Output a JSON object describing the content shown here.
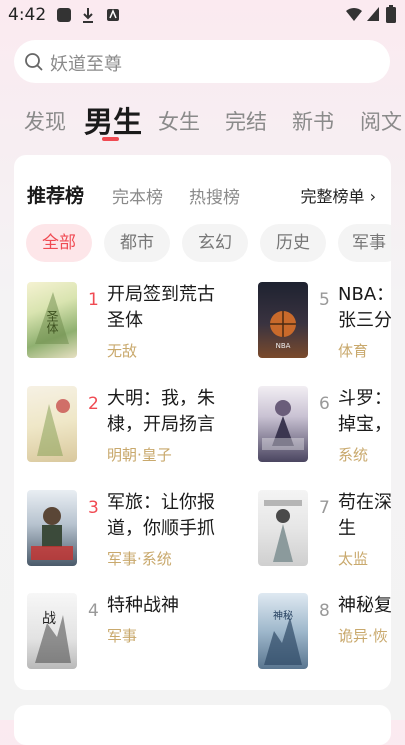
{
  "status": {
    "time": "4:42"
  },
  "search": {
    "placeholder": "妖道至尊"
  },
  "nav_tabs": [
    {
      "label": "发现"
    },
    {
      "label": "男生"
    },
    {
      "label": "女生"
    },
    {
      "label": "完结"
    },
    {
      "label": "新书"
    },
    {
      "label": "阅文"
    }
  ],
  "rank_tabs": [
    {
      "label": "推荐榜"
    },
    {
      "label": "完本榜"
    },
    {
      "label": "热搜榜"
    }
  ],
  "full_list_label": "完整榜单 ›",
  "categories": [
    {
      "label": "全部"
    },
    {
      "label": "都市"
    },
    {
      "label": "玄幻"
    },
    {
      "label": "历史"
    },
    {
      "label": "军事"
    }
  ],
  "books": [
    {
      "rank": "1",
      "title_line1": "开局签到荒古",
      "title_line2": "圣体",
      "tag": "无敌"
    },
    {
      "rank": "2",
      "title_line1": "大明：我，朱",
      "title_line2": "棣，开局扬言",
      "tag": "明朝·皇子"
    },
    {
      "rank": "3",
      "title_line1": "军旅：让你报",
      "title_line2": "道，你顺手抓",
      "tag": "军事·系统"
    },
    {
      "rank": "4",
      "title_line1": "特种战神",
      "title_line2": "",
      "tag": "军事"
    },
    {
      "rank": "5",
      "title_line1": "NBA：",
      "title_line2": "张三分",
      "tag": "体育"
    },
    {
      "rank": "6",
      "title_line1": "斗罗：",
      "title_line2": "掉宝，",
      "tag": "系统"
    },
    {
      "rank": "7",
      "title_line1": "苟在深",
      "title_line2": "生",
      "tag": "太监"
    },
    {
      "rank": "8",
      "title_line1": "神秘复",
      "title_line2": "",
      "tag": "诡异·恢"
    }
  ],
  "colors": {
    "accent": "#f04a52",
    "tag": "#c9a96d",
    "chip_bg": "#f4f4f4"
  }
}
